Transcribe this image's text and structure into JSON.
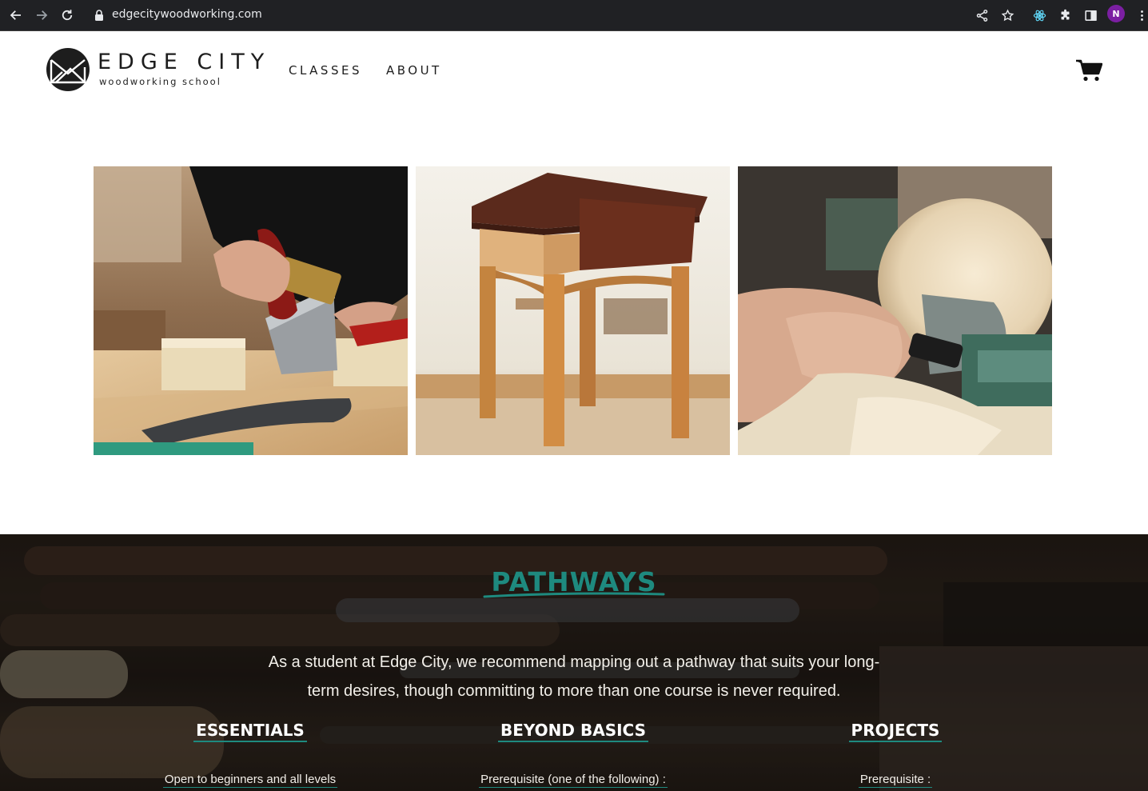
{
  "browser": {
    "url": "edgecitywoodworking.com",
    "profile_initial": "N"
  },
  "header": {
    "logo_title": "EDGE CITY",
    "logo_subtitle": "woodworking school",
    "nav": [
      {
        "label": "CLASSES"
      },
      {
        "label": "ABOUT"
      }
    ]
  },
  "gallery": {
    "images": [
      {
        "subject": "hand-sawing-wood"
      },
      {
        "subject": "wooden-side-table"
      },
      {
        "subject": "wood-turning-lathe"
      }
    ]
  },
  "pathways": {
    "title": "PATHWAYS",
    "intro": "As a student at Edge City, we recommend mapping out a pathway that suits your long-term desires, though committing to more than one course is never required.",
    "columns": [
      {
        "heading": "ESSENTIALS",
        "subtext": "Open to beginners and all levels"
      },
      {
        "heading": "BEYOND BASICS",
        "subtext": "Prerequisite (one of the following) :"
      },
      {
        "heading": "PROJECTS",
        "subtext": "Prerequisite :"
      }
    ],
    "accent_color": "#1e8a7f"
  },
  "icons": [
    "back-arrow-icon",
    "forward-arrow-icon",
    "reload-icon",
    "lock-icon",
    "share-icon",
    "star-icon",
    "react-devtools-icon",
    "extensions-icon",
    "sidepanel-icon",
    "menu-dots-icon",
    "cart-icon"
  ]
}
